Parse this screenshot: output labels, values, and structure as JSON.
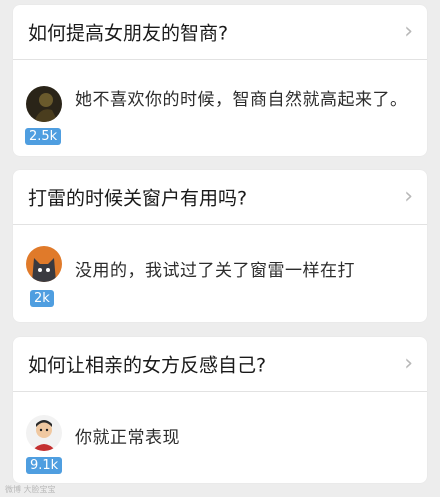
{
  "cards": [
    {
      "question": "如何提高女朋友的智商?",
      "answer": "她不喜欢你的时候，智商自然就高起来了。",
      "votes": "2.5k",
      "avatar_icon": "dark-avatar-icon"
    },
    {
      "question": "打雷的时候关窗户有用吗?",
      "answer": "没用的，我试过了关了窗雷一样在打",
      "votes": "2k",
      "avatar_icon": "cat-avatar-icon"
    },
    {
      "question": "如何让相亲的女方反感自己?",
      "answer": "你就正常表现",
      "votes": "9.1k",
      "avatar_icon": "cartoon-man-avatar-icon"
    }
  ],
  "chevron": "›",
  "watermark": "微博 大脸宝宝",
  "colors": {
    "background": "#ededed",
    "card": "#ffffff",
    "badge": "#4f9ee0",
    "chevron": "#b7b7b7"
  }
}
